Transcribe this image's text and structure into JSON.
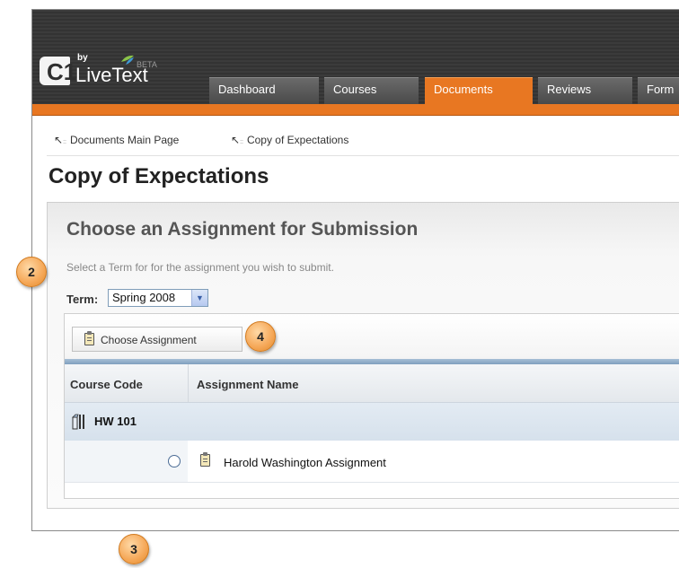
{
  "brand": {
    "logo_text": "C1",
    "by": "by",
    "name": "LiveText",
    "beta": "BETA"
  },
  "nav": {
    "tabs": [
      {
        "label": "Dashboard",
        "active": false
      },
      {
        "label": "Courses",
        "active": false
      },
      {
        "label": "Documents",
        "active": true
      },
      {
        "label": "Reviews",
        "active": false
      },
      {
        "label": "Form",
        "active": false
      }
    ]
  },
  "breadcrumbs": [
    "Documents Main Page",
    "Copy of Expectations"
  ],
  "page": {
    "title": "Copy of Expectations"
  },
  "panel": {
    "title": "Choose an Assignment for Submission",
    "hint": "Select a Term for for the assignment you wish to submit.",
    "term_label": "Term:",
    "term_value": "Spring 2008"
  },
  "toolbar": {
    "choose_label": "Choose Assignment"
  },
  "table": {
    "headers": [
      "Course Code",
      "Assignment Name"
    ],
    "groups": [
      {
        "course_code": "HW 101",
        "items": [
          {
            "name": "Harold Washington Assignment",
            "selected": false
          }
        ]
      }
    ]
  },
  "callouts": [
    "2",
    "3",
    "4"
  ],
  "colors": {
    "accent": "#e87722",
    "topbar": "#383838",
    "link_blue": "#4b6c95"
  }
}
